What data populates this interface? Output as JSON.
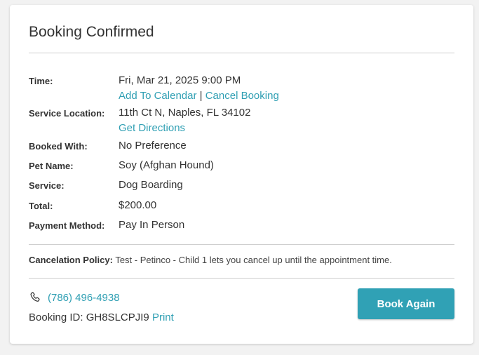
{
  "header": {
    "title": "Booking Confirmed"
  },
  "details": {
    "time": {
      "label": "Time:",
      "value": "Fri, Mar 21, 2025 9:00 PM",
      "add_to_calendar": "Add To Calendar",
      "separator": "|",
      "cancel_booking": "Cancel Booking"
    },
    "location": {
      "label": "Service Location:",
      "value": "11th Ct N, Naples, FL 34102",
      "directions": "Get Directions"
    },
    "booked_with": {
      "label": "Booked With:",
      "value": "No Preference"
    },
    "pet_name": {
      "label": "Pet Name:",
      "value": "Soy (Afghan Hound)"
    },
    "service": {
      "label": "Service:",
      "value": "Dog Boarding"
    },
    "total": {
      "label": "Total:",
      "value": "$200.00"
    },
    "payment_method": {
      "label": "Payment Method:",
      "value": "Pay In Person"
    }
  },
  "policy": {
    "label": "Cancelation Policy:",
    "text": "Test - Petinco - Child 1 lets you cancel up until the appointment time."
  },
  "footer": {
    "phone_icon": "phone-icon",
    "phone": "(786) 496-4938",
    "booking_id_label": "Booking ID:",
    "booking_id": "GH8SLCPJI9",
    "print": "Print",
    "book_again": "Book Again"
  },
  "colors": {
    "accent": "#30a1b5",
    "link": "#2f9fb3",
    "text": "#333333",
    "divider": "#cfcfcf"
  }
}
